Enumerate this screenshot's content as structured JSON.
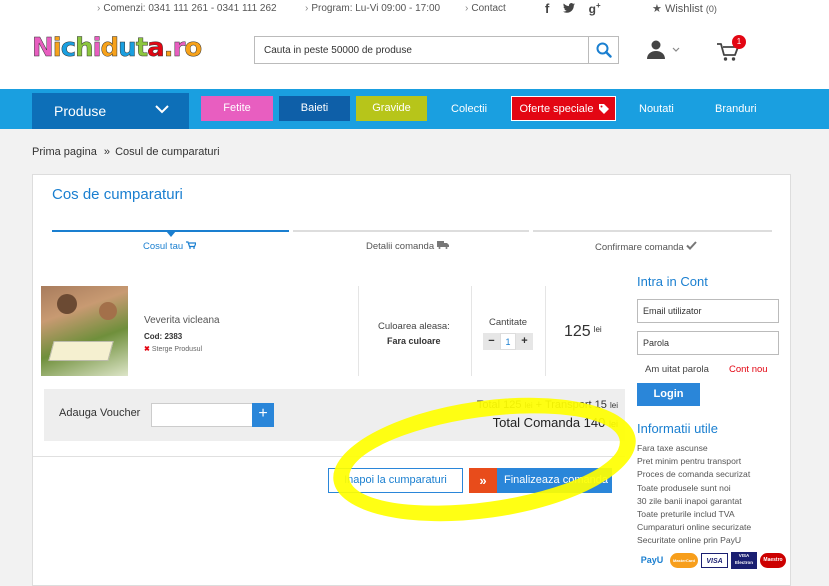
{
  "topbar": {
    "phones": "Comenzi: 0341 111 261 - 0341 111 262",
    "schedule": "Program: Lu-Vi 09:00 - 17:00",
    "contact": "Contact",
    "wishlist_label": "Wishlist",
    "wishlist_count": "(0)"
  },
  "header": {
    "logo_text": "Nichiduta.ro",
    "search_placeholder": "Cauta in peste 50000 de produse",
    "cart_count": "1"
  },
  "nav": {
    "produse": "Produse",
    "items": [
      {
        "label": "Fetite",
        "color": "#e85ec0"
      },
      {
        "label": "Baieti",
        "color": "#0e5fa8"
      },
      {
        "label": "Gravide",
        "color": "#b7c51a"
      },
      {
        "label": "Colectii"
      },
      {
        "label": "Oferte speciale",
        "color": "#e30613"
      },
      {
        "label": "Noutati"
      },
      {
        "label": "Branduri"
      }
    ]
  },
  "breadcrumb": {
    "home": "Prima pagina",
    "sep": "»",
    "current": "Cosul de cumparaturi"
  },
  "cart": {
    "title": "Cos de cumparaturi",
    "steps": [
      {
        "label": "Cosul tau",
        "active": true
      },
      {
        "label": "Detalii comanda",
        "active": false
      },
      {
        "label": "Confirmare comanda",
        "active": false
      }
    ],
    "item": {
      "name": "Veverita vicleana",
      "code": "Cod: 2383",
      "remove": "Sterge Produsul",
      "color_label": "Culoarea aleasa:",
      "color_value": "Fara culoare",
      "qty_label": "Cantitate",
      "qty": "1",
      "price": "125",
      "currency": "lei"
    },
    "voucher_label": "Adauga Voucher",
    "total_text": "Total 125",
    "currency": "lei",
    "transport_text": "+ Transport 15",
    "total_order_text": "Total Comanda 140",
    "back_button": "Inapoi la cumparaturi",
    "finish_button": "Finalizeaza comanda"
  },
  "login": {
    "title": "Intra in Cont",
    "user_placeholder": "Email utilizator",
    "pass_placeholder": "Parola",
    "forgot": "Am uitat parola",
    "new_account": "Cont nou",
    "button": "Login"
  },
  "info": {
    "title": "Informatii utile",
    "items": [
      "Fara taxe ascunse",
      "Pret minim pentru transport",
      "Proces de comanda securizat",
      "Toate produsele sunt noi",
      "30 zile banii inapoi garantat",
      "Toate preturile includ TVA",
      "Cumparaturi online securizate",
      "Securitate online prin PayU"
    ]
  },
  "payments": [
    "PayU",
    "MasterCard",
    "VISA",
    "VISA Electron",
    "Maestro"
  ],
  "colors": {
    "accent": "#1a9fe0",
    "button": "#2a86d9",
    "highlight": "#ffff00",
    "sale": "#e30613"
  }
}
